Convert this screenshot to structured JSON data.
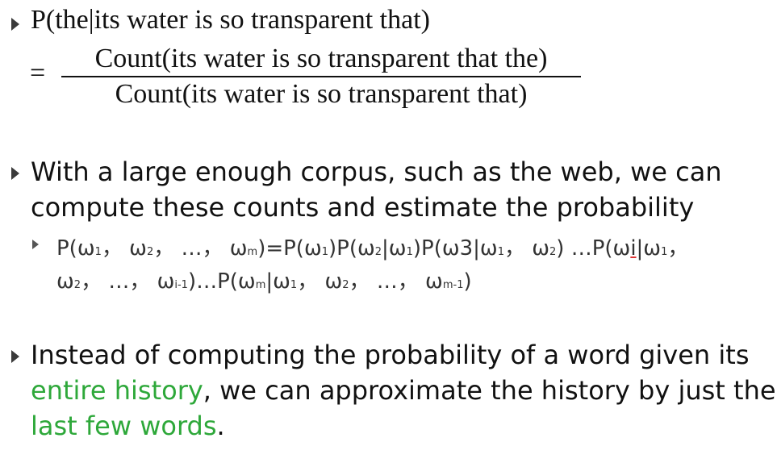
{
  "bullet1": {
    "text": "P(the|its water is so transparent that)",
    "equals": "=",
    "numerator": "Count(its water is so transparent that the)",
    "denominator": "Count(its water is so transparent that)"
  },
  "bullet2": {
    "line1": "With a large enough corpus, such as the web, we can",
    "line2": "compute these counts and estimate the probability",
    "formula": {
      "l1_a": "P(ω",
      "s1": "1",
      "l1_b": "， ω",
      "s2": "2",
      "l1_c": "， …， ω",
      "sm": "m",
      "l1_d": ")=P(ω",
      "s3": "1",
      "l1_e": ")P(ω",
      "s4": "2",
      "l1_f": "|ω",
      "s5": "1",
      "l1_g": ")P(ω3|ω",
      "s6": "1",
      "l1_h": "， ω",
      "s7": "2",
      "l1_i": ") …P(ω",
      "l1_i_u": "i",
      "l1_j": "|ω",
      "s8": "1",
      "l1_k": "，",
      "l2_a": "ω",
      "s9": "2",
      "l2_b": "， …， ω",
      "s10": "i-1",
      "l2_c": ")…P(ω",
      "s11": "m",
      "l2_d": "|ω",
      "s12": "1",
      "l2_e": "， ω",
      "s13": "2",
      "l2_f": "， …， ω",
      "s14": "m-1",
      "l2_g": ")"
    }
  },
  "bullet3": {
    "line1": "Instead of computing the probability of a word given its",
    "line2_green": "entire history",
    "line2_rest": ", we can approximate the history by just the",
    "line3_green": "last few words",
    "line3_rest": "."
  },
  "colors": {
    "accent_green": "#2ea83a",
    "bullet": "#3a3a3a"
  }
}
